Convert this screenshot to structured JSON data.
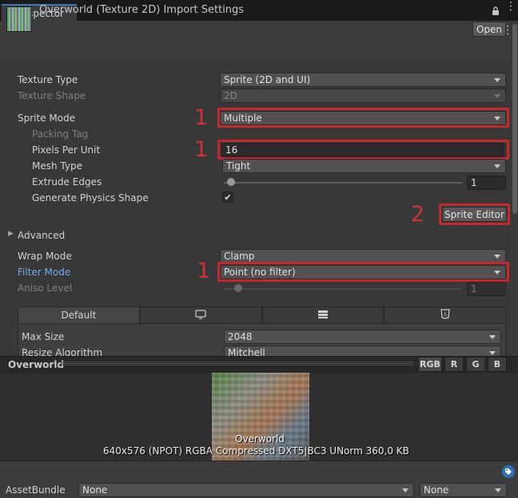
{
  "tab": {
    "label": "Inspector",
    "lock_icon": "lock-icon",
    "menu_icon": "kebab-menu-icon"
  },
  "header": {
    "title": "Overworld (Texture 2D) Import Settings",
    "open_label": "Open",
    "help_icon": "help-icon",
    "preset_icon": "preset-sliders-icon",
    "menu_icon": "kebab-menu-icon"
  },
  "props": {
    "texture_type": {
      "label": "Texture Type",
      "value": "Sprite (2D and UI)"
    },
    "texture_shape": {
      "label": "Texture Shape",
      "value": "2D"
    },
    "sprite_mode": {
      "label": "Sprite Mode",
      "value": "Multiple",
      "step": "1"
    },
    "packing_tag": {
      "label": "Packing Tag"
    },
    "pixels_per_unit": {
      "label": "Pixels Per Unit",
      "value": "16",
      "step": "1"
    },
    "mesh_type": {
      "label": "Mesh Type",
      "value": "Tight"
    },
    "extrude_edges": {
      "label": "Extrude Edges",
      "value": "1",
      "fraction": 0.03
    },
    "generate_physics_shape": {
      "label": "Generate Physics Shape",
      "checked": "✔"
    },
    "sprite_editor": {
      "label": "Sprite Editor",
      "step": "2"
    },
    "advanced": {
      "label": "Advanced"
    },
    "wrap_mode": {
      "label": "Wrap Mode",
      "value": "Clamp"
    },
    "filter_mode": {
      "label": "Filter Mode",
      "value": "Point (no filter)",
      "step": "1"
    },
    "aniso_level": {
      "label": "Aniso Level",
      "value": "1",
      "fraction": 0.06
    },
    "platform_tabs": [
      "Default",
      "",
      "",
      ""
    ],
    "platform_icons": [
      "",
      "monitor-icon",
      "server-icon",
      "html5-icon"
    ],
    "max_size": {
      "label": "Max Size",
      "value": "2048"
    },
    "resize_algorithm": {
      "label": "Resize Algorithm",
      "value": "Mitchell"
    }
  },
  "preview": {
    "title": "Overworld",
    "channels": [
      "RGB",
      "R",
      "G",
      "B"
    ],
    "caption": "Overworld",
    "info": "640x576 (NPOT)  RGBA Compressed DXT5|BC3 UNorm   360,0 KB"
  },
  "bottom": {
    "assetbundle_label": "AssetBundle",
    "bundle_name": "None",
    "bundle_variant": "None",
    "tag_icon": "tag-icon"
  },
  "colors": {
    "accent": "#3a79bb",
    "highlight": "#c4282b",
    "link": "#74a9ec"
  }
}
